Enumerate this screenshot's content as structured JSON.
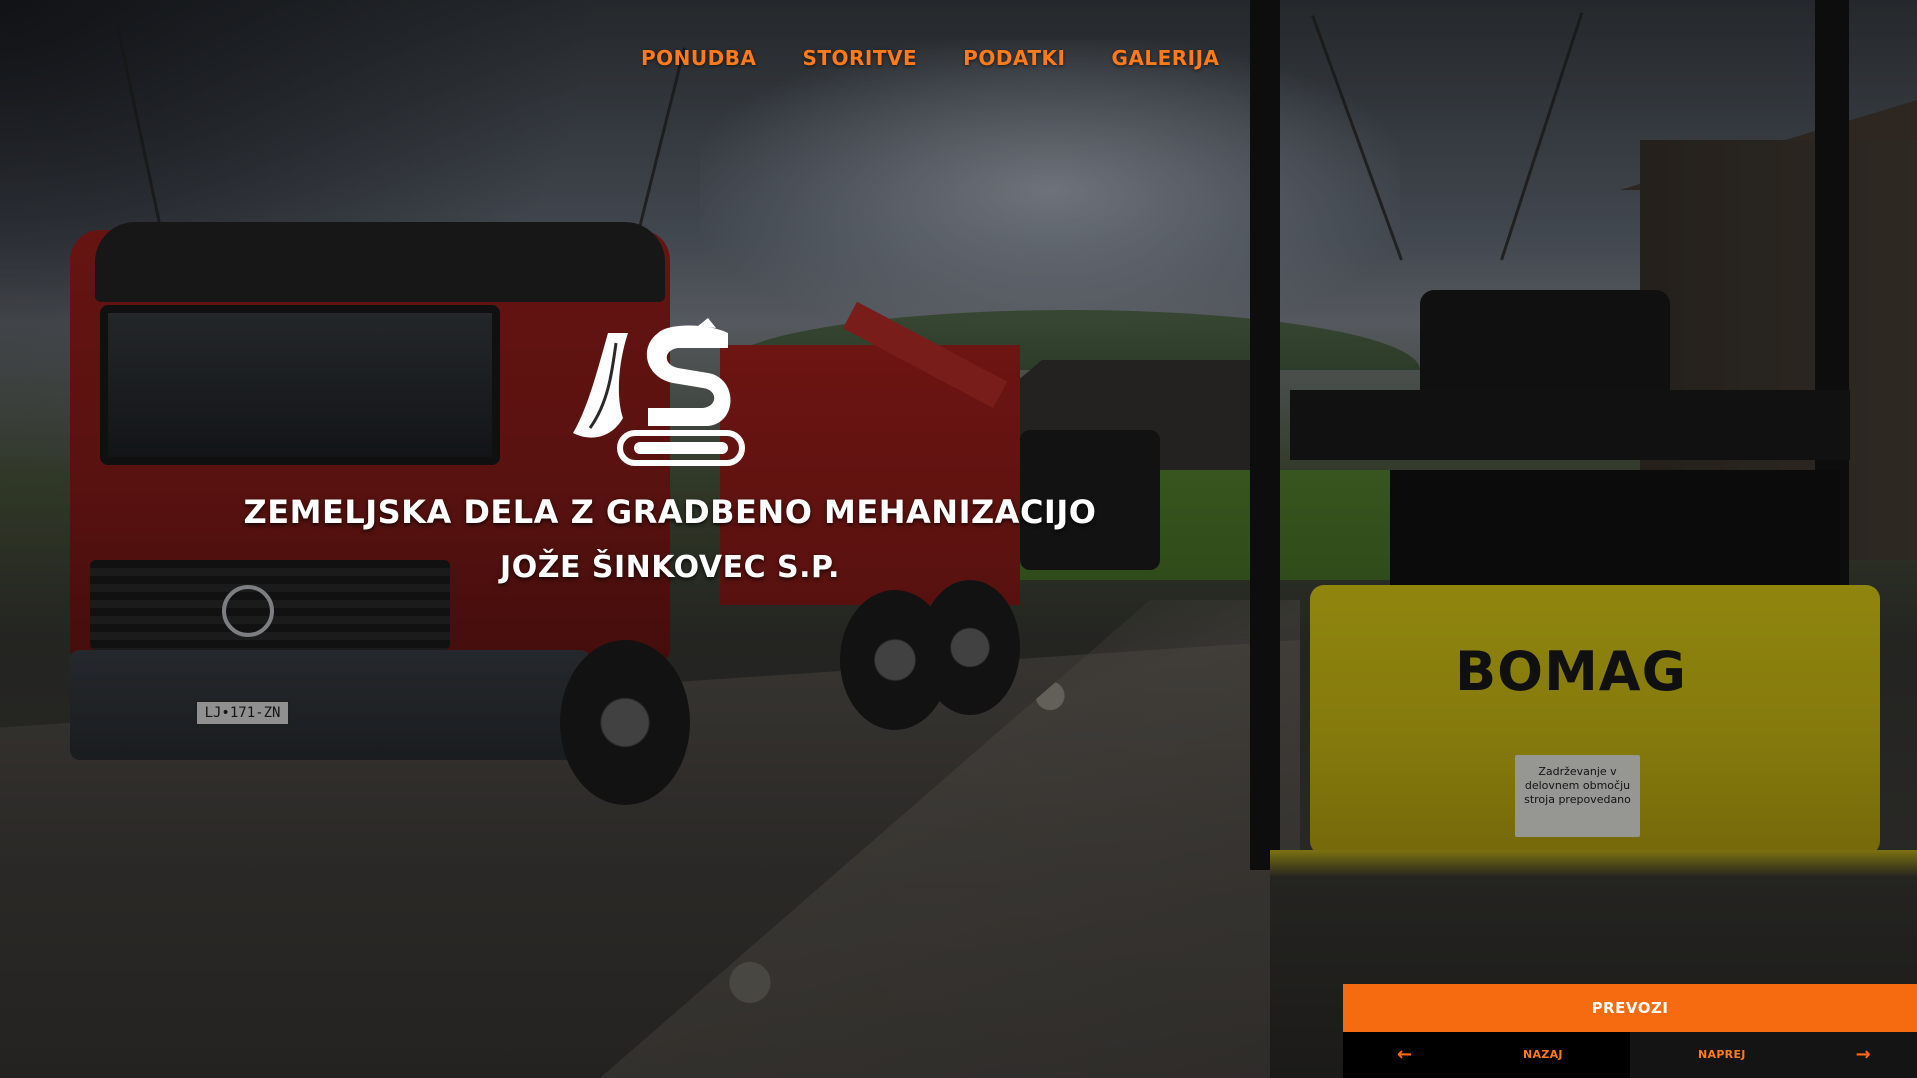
{
  "nav": {
    "items": [
      {
        "label": "PONUDBA"
      },
      {
        "label": "STORITVE"
      },
      {
        "label": "PODATKI"
      },
      {
        "label": "GALERIJA"
      }
    ]
  },
  "hero": {
    "title": "ZEMELJSKA DELA Z GRADBENO MEHANIZACIJO",
    "subtitle": "JOŽE ŠINKOVEC S.P.",
    "photo": {
      "plate_text": "LJ•171-ZN",
      "machine_brand": "BOMAG",
      "warning_sign": "Zadrževanje v delovnem območju stroja prepovedano"
    }
  },
  "slider": {
    "current_label": "PREVOZI",
    "prev_label": "NAZAJ",
    "next_label": "NAPREJ",
    "prev_icon": "arrow-left-icon",
    "next_icon": "arrow-right-icon"
  },
  "colors": {
    "accent": "#f76b10",
    "nav_text": "#ff7a1a",
    "text": "#ffffff"
  }
}
